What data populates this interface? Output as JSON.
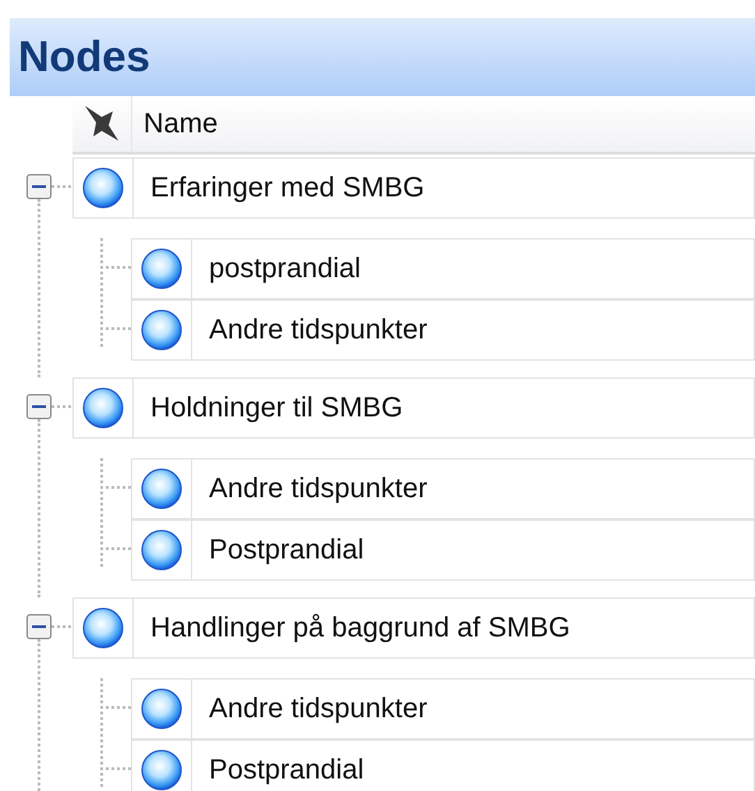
{
  "panel": {
    "title": "Nodes"
  },
  "table": {
    "columns": [
      "Name"
    ],
    "nodes": [
      {
        "name": "Erfaringer med SMBG",
        "expanded": true,
        "children": [
          {
            "name": "postprandial"
          },
          {
            "name": "Andre tidspunkter"
          }
        ]
      },
      {
        "name": "Holdninger til SMBG",
        "expanded": true,
        "children": [
          {
            "name": "Andre tidspunkter"
          },
          {
            "name": "Postprandial"
          }
        ]
      },
      {
        "name": "Handlinger på baggrund af SMBG",
        "expanded": true,
        "children": [
          {
            "name": "Andre tidspunkter"
          },
          {
            "name": "Postprandial"
          }
        ]
      }
    ]
  }
}
